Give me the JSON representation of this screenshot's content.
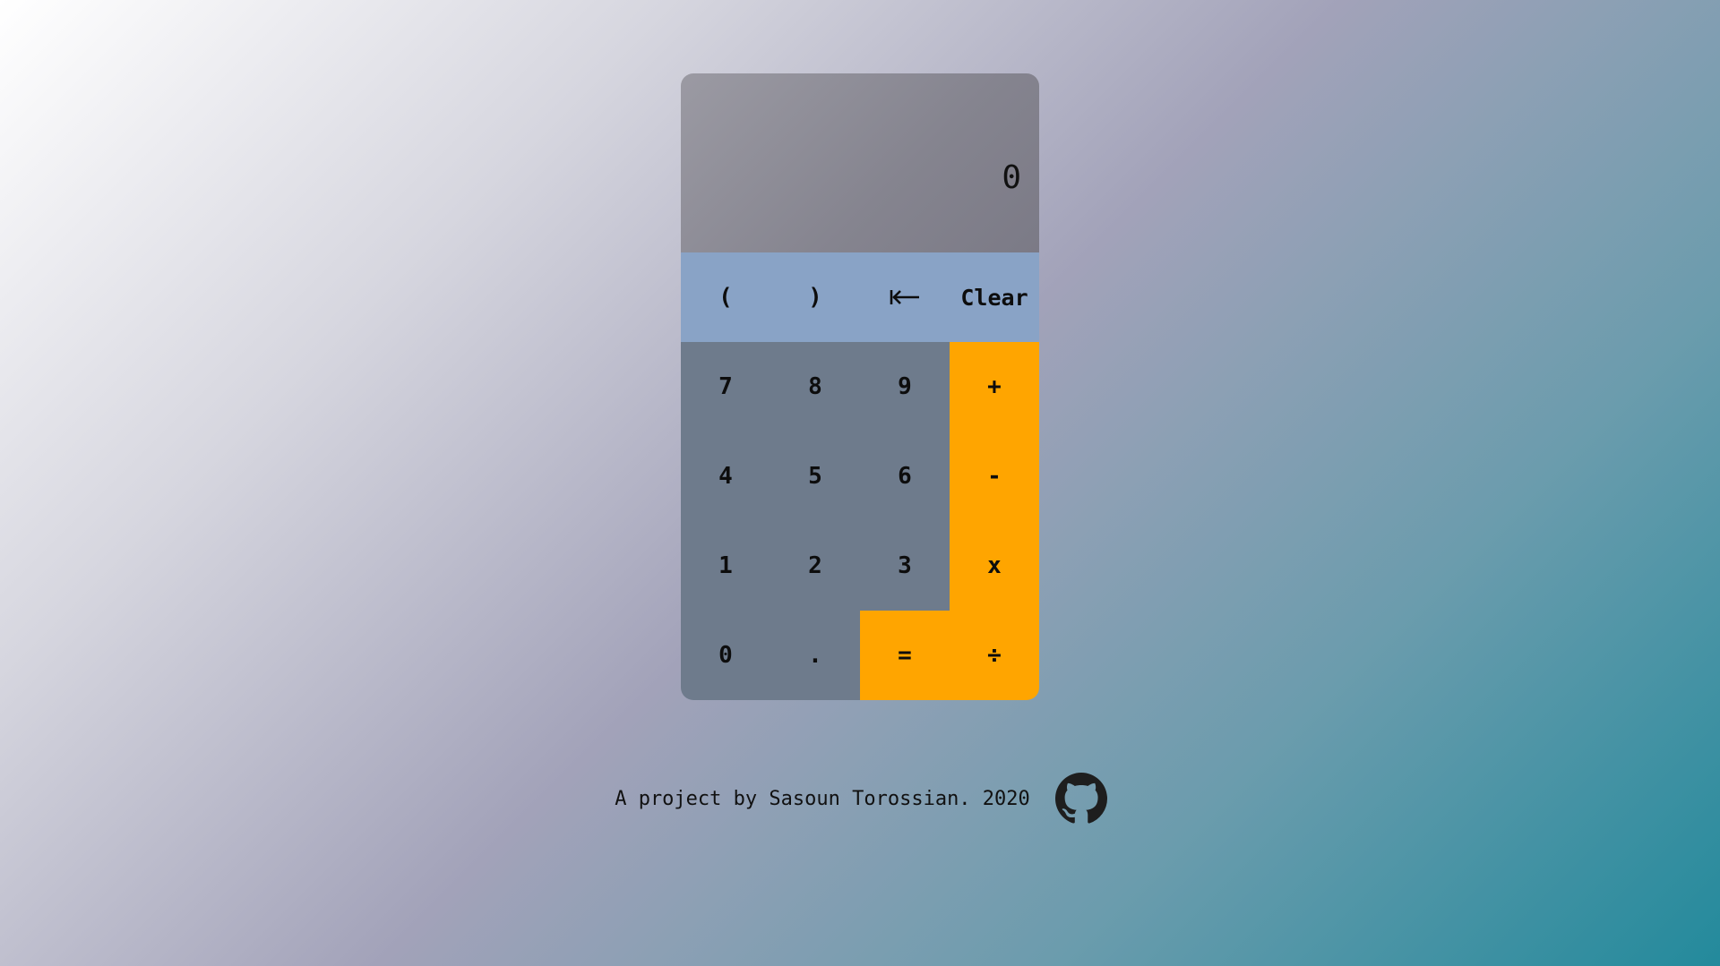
{
  "calculator": {
    "display": "0",
    "keys": {
      "open_paren": "(",
      "close_paren": ")",
      "backspace": "⇤",
      "clear": "Clear",
      "seven": "7",
      "eight": "8",
      "nine": "9",
      "plus": "+",
      "four": "4",
      "five": "5",
      "six": "6",
      "minus": "-",
      "one": "1",
      "two": "2",
      "three": "3",
      "multiply": "x",
      "zero": "0",
      "decimal": ".",
      "equals": "=",
      "divide": "÷"
    }
  },
  "footer": {
    "text": "A project by Sasoun Torossian. 2020",
    "icon": "github-icon"
  },
  "colors": {
    "function_keys": "#89a3c6",
    "number_keys": "#6e7b8c",
    "operator_keys": "#ffa500"
  }
}
